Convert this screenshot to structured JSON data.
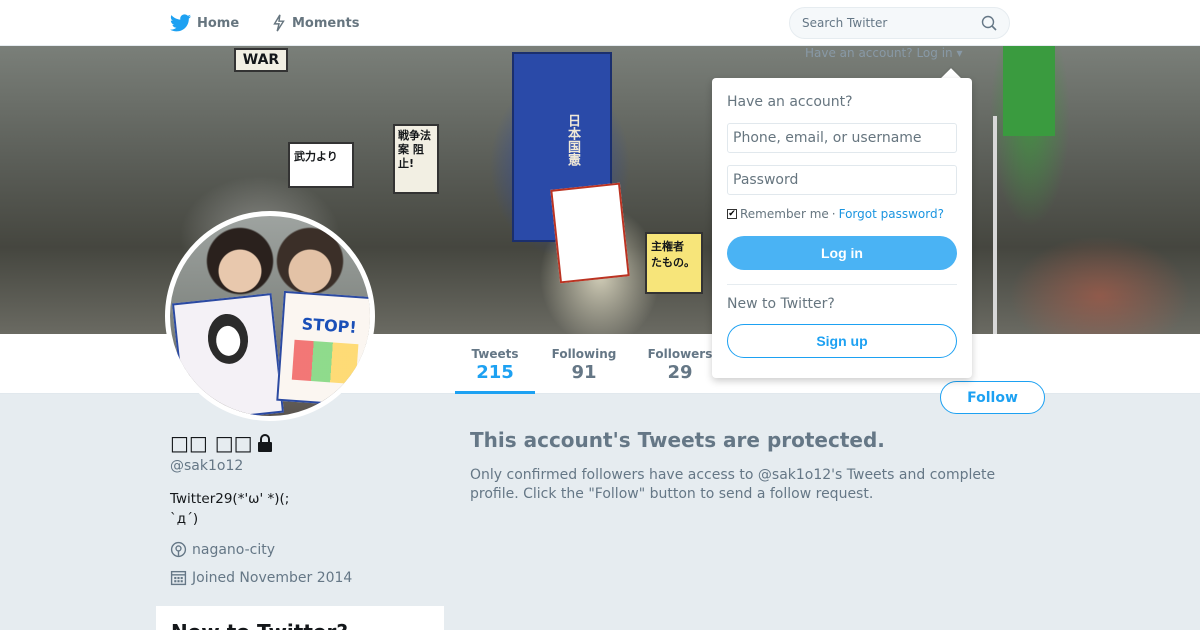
{
  "nav": {
    "home_label": "Home",
    "moments_label": "Moments",
    "search_placeholder": "Search Twitter",
    "have_account_text": "Have an account? Log in"
  },
  "banner": {
    "signs": [
      "WAR",
      "戦争法案 阻止!",
      "武力より",
      "主権者 たもの。",
      "日本国憲"
    ]
  },
  "avatar": {
    "poster_text": "STOP!"
  },
  "profile": {
    "name": "□□ □□",
    "handle": "@sak1o12",
    "bio": "Twitter29(*'ω' *)(;\n`д´)",
    "location": "nagano-city",
    "joined": "Joined November 2014"
  },
  "stats": {
    "tweets": {
      "label": "Tweets",
      "value": "215"
    },
    "following": {
      "label": "Following",
      "value": "91"
    },
    "followers": {
      "label": "Followers",
      "value": "29"
    }
  },
  "follow_button": "Follow",
  "protected": {
    "title": "This account's Tweets are protected.",
    "body": "Only confirmed followers have access to @sak1o12's Tweets and complete profile. Click the \"Follow\" button to send a follow request."
  },
  "new_to_twitter_card": {
    "title": "New to Twitter?"
  },
  "login": {
    "heading": "Have an account?",
    "username_placeholder": "Phone, email, or username",
    "password_placeholder": "Password",
    "remember_label": "Remember me",
    "separator": "·",
    "forgot_label": "Forgot password?",
    "login_label": "Log in",
    "new_heading": "New to Twitter?",
    "signup_label": "Sign up"
  },
  "colors": {
    "accent": "#1da1f2",
    "login_button": "#4ab3f4",
    "background": "#e6ecf0"
  }
}
